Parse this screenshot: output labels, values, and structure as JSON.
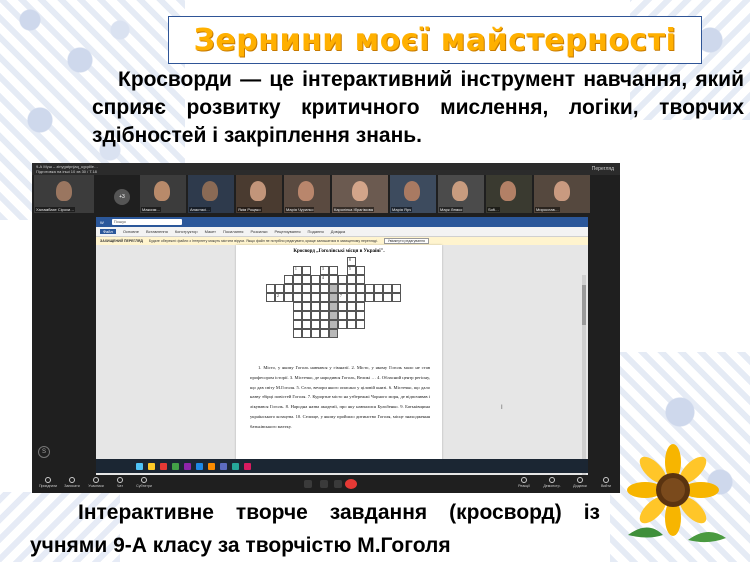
{
  "title": "Зернини моєї майстерності",
  "intro_text": "Кросворди — це інтерактивний інструмент навчання, який сприяє розвитку критичного мислення, логіки, творчих здібностей і закріплення знань.",
  "caption": "Інтерактивне творче завдання (кросворд) із учнями 9-А класу за творчістю М.Гоголя",
  "meeting": {
    "window_title": "9-А Муш – zinygatpnjaq_ugqdile…",
    "subtitle": "Підготовка на інші 10 хв 30 / Т.18",
    "view_label": "Перегляд",
    "more_count": "+3",
    "participants": [
      "Халамбахе Сірохи…",
      "Максим…",
      "Анастасі…",
      "Якім Роцвко",
      "Марія Чурилко",
      "Каролінка Ібрагімова",
      "Марія Ярч",
      "Марк Лемко",
      "Sofi…",
      "Мирослав…"
    ],
    "controls": [
      "Приєднати",
      "Записати",
      "Учасники",
      "Чат",
      "Субтитри",
      "Реакції",
      "Демонстр.",
      "Додатки",
      "Вийти"
    ]
  },
  "word_app": {
    "search_placeholder": "Пошук",
    "tabs": [
      "Файл",
      "Основне",
      "Вставлення",
      "Конструктор",
      "Макет",
      "Посилання",
      "Розсилки",
      "Рецензування",
      "Подання",
      "Довідка"
    ],
    "warning_label": "ЗАХИЩЕНИЙ ПЕРЕГЛЯД",
    "warning_text": "Будьте обережні: файли з Інтернету можуть містити віруси. Якщо файл не потрібно редагувати, краще залишатися в захищеному перегляді.",
    "warning_button": "Увімкнути редагування",
    "doc_title": "Кросворд „Гоголівські місця в Україні\".",
    "doc_text": "1. Місто, у якому Гоголь навчався у гімназії. 2. Місто, у якому Гоголь мало не став професором історії. 3. Містечко, де народився Гоголь, Великі … 4. Обласний центр регіону, що дав світу М.Гоголя. 5. Село, вечори якого описано у ціловій книзі. 6. Містечко, що дало назву збірці повістей Гоголя. 7. Курортне місто на узбережжі Чорного моря, де відпочивав і лікувався Гоголь. 8. Народна назва академії, про яку навчалися Бульбенко. 9. Батьківщина українського козацтва. 10. Селище, у якому пройшло дитинство Гоголя, місце знаходження батьківського маєтку.",
    "status_text": "Сторінка 1 з 1    Слів: 154",
    "cw_numbers": [
      "1",
      "3",
      "4",
      "5",
      "6",
      "8",
      "2",
      "7"
    ]
  }
}
